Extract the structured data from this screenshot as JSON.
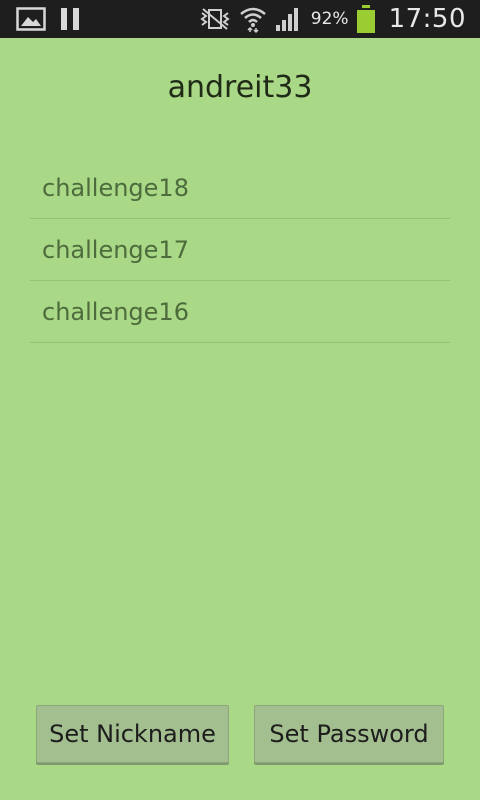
{
  "status_bar": {
    "icons_left": [
      "gallery-icon",
      "pause-icon"
    ],
    "icons_right": [
      "vibrate-mute-icon",
      "wifi-icon",
      "signal-icon",
      "battery-icon"
    ],
    "battery_percent": "92%",
    "battery_level": 0.92,
    "time": "17:50",
    "battery_color": "#9acd32"
  },
  "profile": {
    "nickname": "andreit33"
  },
  "challenges": [
    {
      "label": "challenge18"
    },
    {
      "label": "challenge17"
    },
    {
      "label": "challenge16"
    }
  ],
  "actions": {
    "set_nickname_label": "Set Nickname",
    "set_password_label": "Set Password"
  },
  "colors": {
    "background": "#a9d986",
    "status_bar": "#1e1e1e",
    "list_text": "#4e6b3d",
    "button": "#a3be8f"
  }
}
